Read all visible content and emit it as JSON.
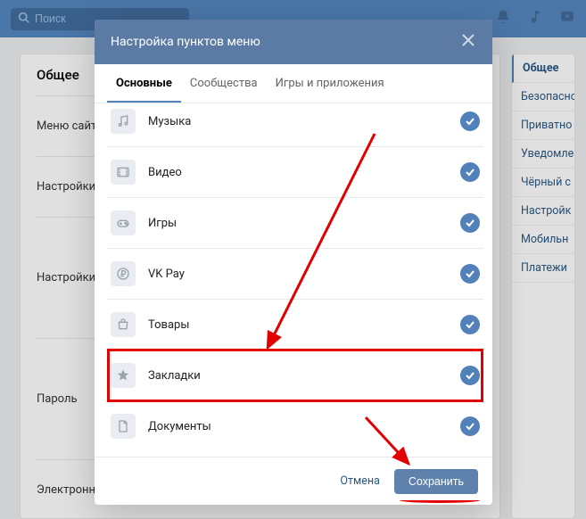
{
  "search": {
    "placeholder": "Поиск"
  },
  "bg": {
    "title": "Общее",
    "rows": [
      "Меню сайта",
      "Настройки",
      "Настройки",
      "Пароль",
      "Электронная почта"
    ],
    "right": [
      "Общее",
      "Безопасно",
      "Приватно",
      "Уведомле",
      "Чёрный с",
      "Настройк",
      "Мобильн",
      "Платежи"
    ]
  },
  "modal": {
    "title": "Настройка пунктов меню",
    "tabs": [
      "Основные",
      "Сообщества",
      "Игры и приложения"
    ],
    "activeTab": 0,
    "items": [
      {
        "label": "Музыка",
        "icon": "music"
      },
      {
        "label": "Видео",
        "icon": "video"
      },
      {
        "label": "Игры",
        "icon": "games"
      },
      {
        "label": "VK Pay",
        "icon": "ruble"
      },
      {
        "label": "Товары",
        "icon": "bag"
      },
      {
        "label": "Закладки",
        "icon": "star",
        "highlight": true
      },
      {
        "label": "Документы",
        "icon": "doc"
      }
    ],
    "cancel": "Отмена",
    "save": "Сохранить"
  }
}
